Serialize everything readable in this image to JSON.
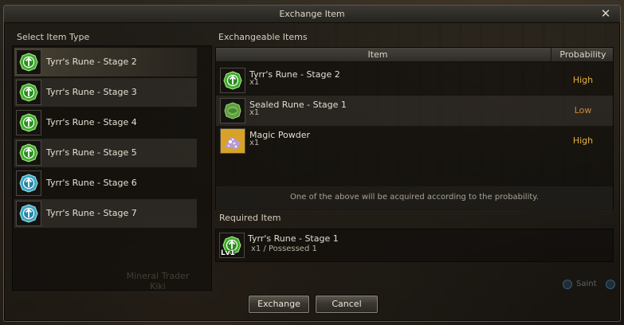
{
  "window": {
    "title": "Exchange Item",
    "close_icon": "close-icon"
  },
  "left": {
    "heading": "Select Item Type",
    "items": [
      {
        "label": "Tyrr's Rune - Stage 2",
        "icon": "green-rune-icon",
        "color": "#3fae2e"
      },
      {
        "label": "Tyrr's Rune - Stage 3",
        "icon": "green-rune-icon",
        "color": "#3fae2e"
      },
      {
        "label": "Tyrr's Rune - Stage 4",
        "icon": "green-rune-icon",
        "color": "#3fae2e"
      },
      {
        "label": "Tyrr's Rune - Stage 5",
        "icon": "green-rune-icon",
        "color": "#3fae2e"
      },
      {
        "label": "Tyrr's Rune - Stage 6",
        "icon": "blue-rune-icon",
        "color": "#3aa6c4"
      },
      {
        "label": "Tyrr's Rune - Stage 7",
        "icon": "blue-rune-icon",
        "color": "#3aa6c4"
      }
    ],
    "watermark": [
      "Mineral Trader",
      "Kiki"
    ]
  },
  "right": {
    "heading": "Exchangeable Items",
    "columns": {
      "item": "Item",
      "probability": "Probability"
    },
    "rows": [
      {
        "name": "Tyrr's Rune - Stage 2",
        "qty": "x1",
        "probability": "High",
        "prob_color": "#e3b23c",
        "icon": "green-rune-icon"
      },
      {
        "name": "Sealed Rune - Stage 1",
        "qty": "x1",
        "probability": "Low",
        "prob_color": "#c98a3a",
        "icon": "sealed-rune-icon"
      },
      {
        "name": "Magic Powder",
        "qty": "x1",
        "probability": "High",
        "prob_color": "#e3b23c",
        "icon": "magic-powder-icon"
      }
    ],
    "note": "One of the above will be acquired according to the probability."
  },
  "required": {
    "heading": "Required Item",
    "name": "Tyrr's Rune - Stage 1",
    "qty": "x1 / Possessed 1",
    "level": "Lv1",
    "icon": "green-rune-icon"
  },
  "buttons": {
    "exchange": "Exchange",
    "cancel": "Cancel"
  },
  "background_label": "Saint"
}
